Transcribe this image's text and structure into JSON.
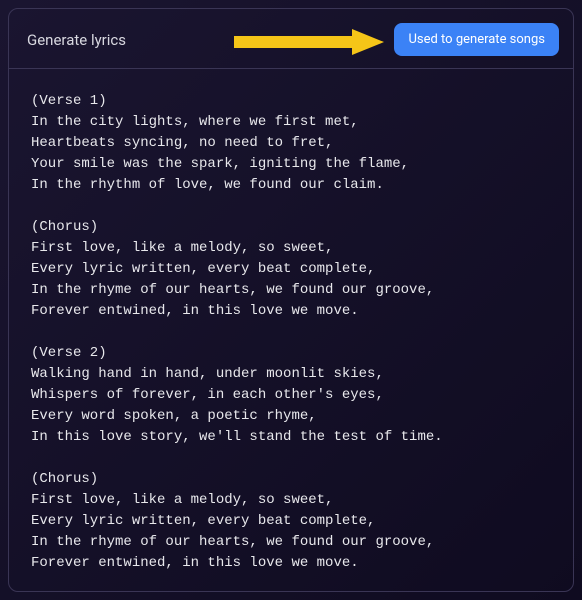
{
  "header": {
    "title": "Generate lyrics",
    "button_label": "Used to generate songs"
  },
  "lyrics_text": "(Verse 1)\nIn the city lights, where we first met,\nHeartbeats syncing, no need to fret,\nYour smile was the spark, igniting the flame,\nIn the rhythm of love, we found our claim.\n\n(Chorus)\nFirst love, like a melody, so sweet,\nEvery lyric written, every beat complete,\nIn the rhyme of our hearts, we found our groove,\nForever entwined, in this love we move.\n\n(Verse 2)\nWalking hand in hand, under moonlit skies,\nWhispers of forever, in each other's eyes,\nEvery word spoken, a poetic rhyme,\nIn this love story, we'll stand the test of time.\n\n(Chorus)\nFirst love, like a melody, so sweet,\nEvery lyric written, every beat complete,\nIn the rhyme of our hearts, we found our groove,\nForever entwined, in this love we move.",
  "annotation": {
    "arrow_color": "#f5c518"
  }
}
